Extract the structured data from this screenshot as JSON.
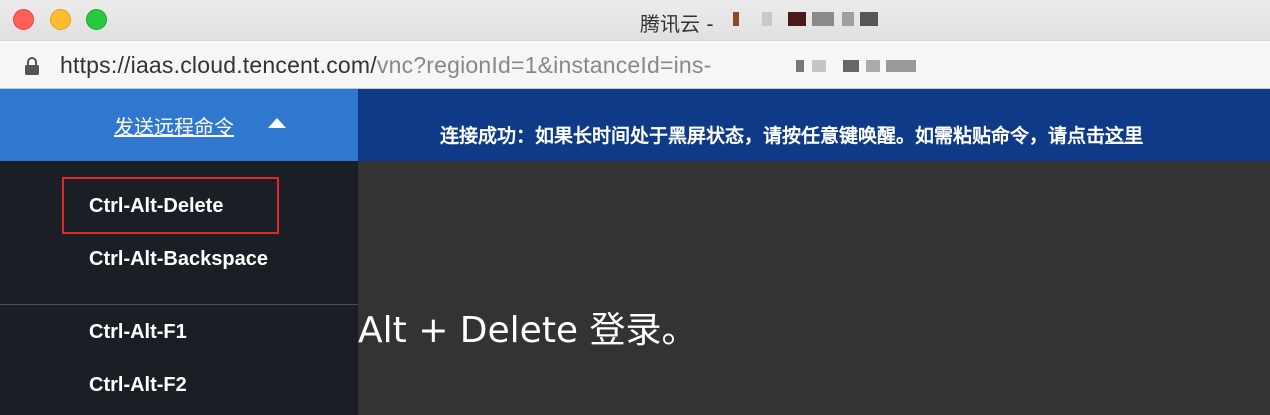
{
  "window": {
    "title": "腾讯云 -"
  },
  "browser": {
    "url_host": "https://iaas.cloud.tencent.com/",
    "url_path": "vnc?regionId=1&instanceId=ins-"
  },
  "header": {
    "send_command_label": "发送远程命令",
    "notice_text": "连接成功：如果长时间处于黑屏状态，请按任意键唤醒。如需粘贴命令，请点击",
    "notice_link": "这里"
  },
  "menu": {
    "items": [
      {
        "label": "Ctrl-Alt-Delete"
      },
      {
        "label": "Ctrl-Alt-Backspace"
      },
      {
        "label": "Ctrl-Alt-F1"
      },
      {
        "label": "Ctrl-Alt-F2"
      }
    ]
  },
  "remote": {
    "text": "Alt + Delete 登录。"
  },
  "colors": {
    "header_bg": "#0f3a87",
    "send_cmd_bg": "#2f77cf",
    "menu_bg": "#1b1f25",
    "remote_bg": "#333333",
    "highlight": "#e0282a"
  },
  "icons": {
    "lock": "lock-icon",
    "caret": "caret-up-icon"
  }
}
